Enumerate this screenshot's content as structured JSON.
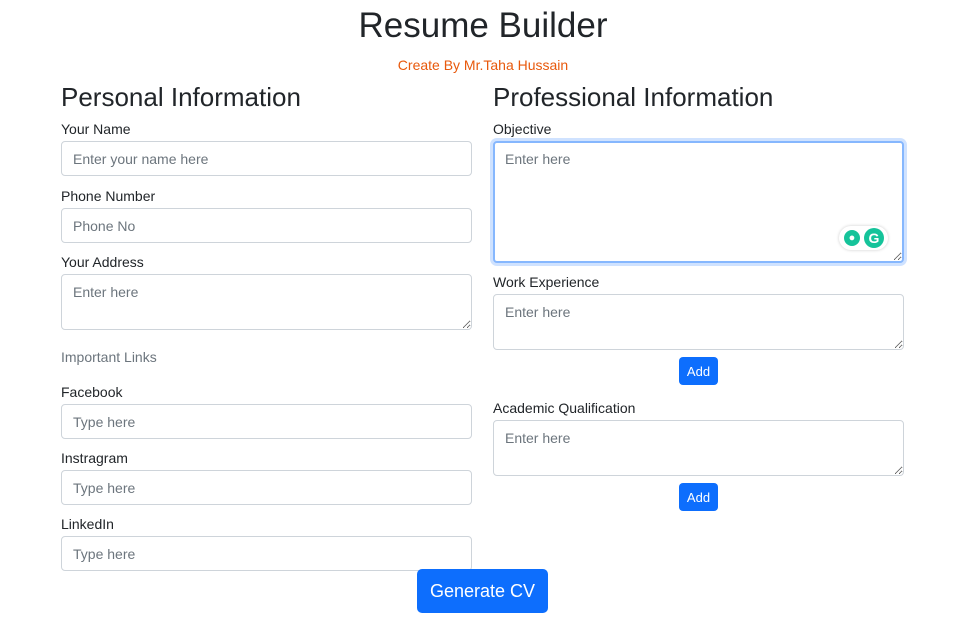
{
  "header": {
    "title": "Resume Builder",
    "subtitle": "Create By Mr.Taha Hussain"
  },
  "personal": {
    "heading": "Personal Information",
    "name_label": "Your Name",
    "name_placeholder": "Enter your name here",
    "phone_label": "Phone Number",
    "phone_placeholder": "Phone No",
    "address_label": "Your Address",
    "address_placeholder": "Enter here",
    "links_heading": "Important Links",
    "facebook_label": "Facebook",
    "facebook_placeholder": "Type here",
    "instagram_label": "Instragram",
    "instagram_placeholder": "Type here",
    "linkedin_label": "LinkedIn",
    "linkedin_placeholder": "Type here"
  },
  "professional": {
    "heading": "Professional Information",
    "objective_label": "Objective",
    "objective_placeholder": "Enter here",
    "work_label": "Work Experience",
    "work_placeholder": "Enter here",
    "work_add": "Add",
    "academic_label": "Academic Qualification",
    "academic_placeholder": "Enter here",
    "academic_add": "Add"
  },
  "footer": {
    "generate_label": "Generate CV"
  },
  "colors": {
    "primary": "#0d6efd",
    "subtitle": "#e8590c",
    "extension": "#15c39a"
  },
  "icons": {
    "grammarly_bulb": "lightbulb-icon",
    "grammarly_logo": "grammarly-icon"
  }
}
